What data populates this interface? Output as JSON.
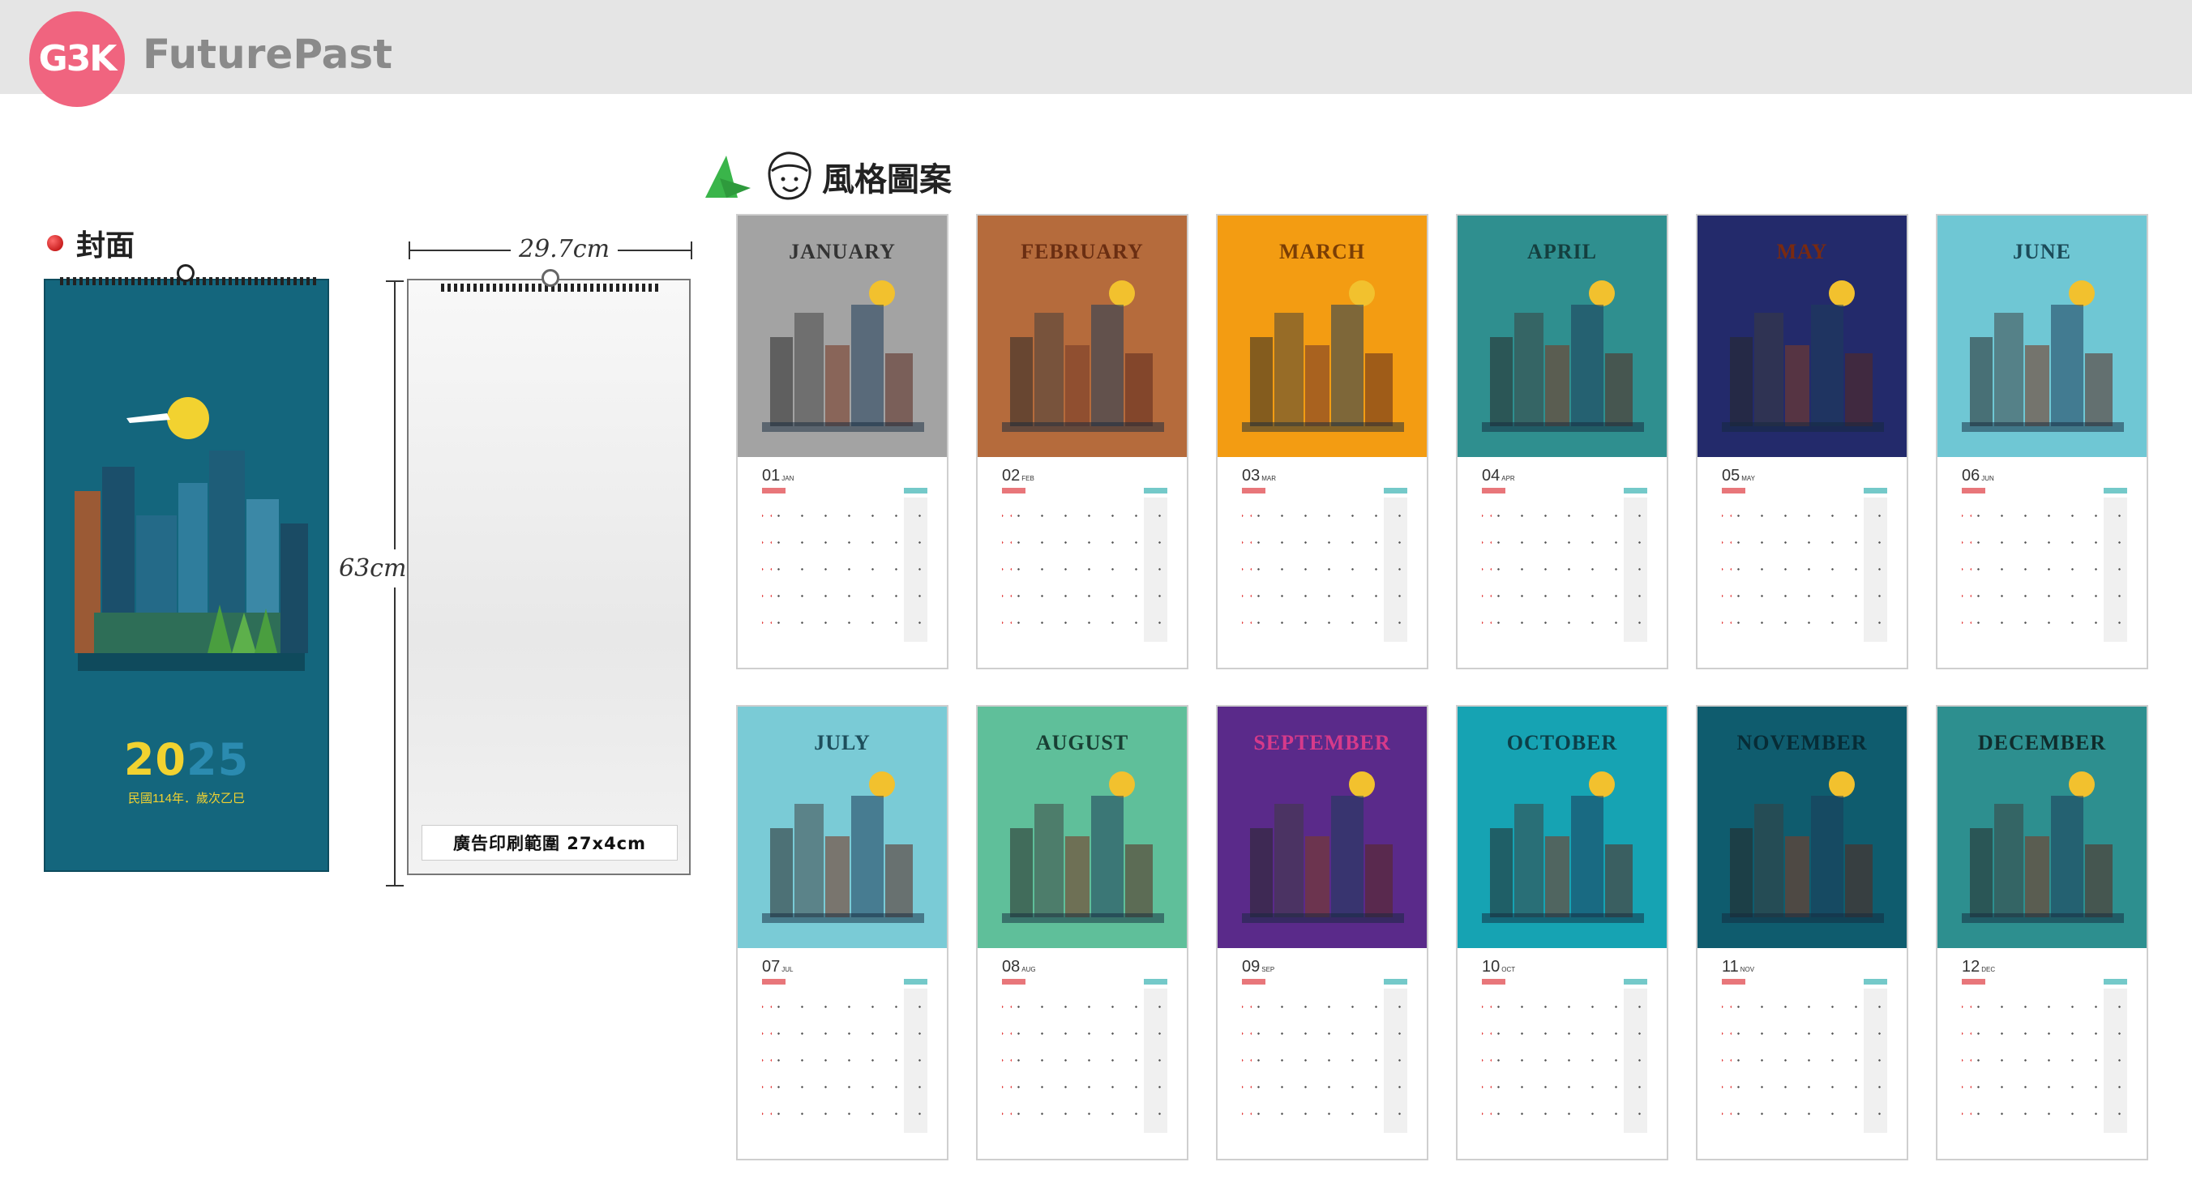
{
  "header": {
    "logo_text": "G3K",
    "brand": "FuturePast"
  },
  "cover_section": {
    "label": "封面",
    "year_part1": "20",
    "year_part2": "25",
    "subtitle": "民國114年．歲次乙巳"
  },
  "dimensions": {
    "width_label": "29.7cm",
    "height_label": "63cm",
    "ad_area_label": "廣告印刷範圍 27x4cm"
  },
  "style_section": {
    "title": "風格圖案"
  },
  "months": [
    {
      "name": "JANUARY",
      "num": "01",
      "abbr": "JAN",
      "bg": "#a3a3a3",
      "title_color": "#333333"
    },
    {
      "name": "FEBRUARY",
      "num": "02",
      "abbr": "FEB",
      "bg": "#b56b3c",
      "title_color": "#6a2e12"
    },
    {
      "name": "MARCH",
      "num": "03",
      "abbr": "MAR",
      "bg": "#f39c12",
      "title_color": "#7a3e05"
    },
    {
      "name": "APRIL",
      "num": "04",
      "abbr": "APR",
      "bg": "#2f8f8f",
      "title_color": "#143f3f"
    },
    {
      "name": "MAY",
      "num": "05",
      "abbr": "MAY",
      "bg": "#232a6b",
      "title_color": "#7a2a10"
    },
    {
      "name": "JUNE",
      "num": "06",
      "abbr": "JUN",
      "bg": "#6fc7d4",
      "title_color": "#1c4b59"
    },
    {
      "name": "JULY",
      "num": "07",
      "abbr": "JUL",
      "bg": "#7acbd6",
      "title_color": "#1d4e5c"
    },
    {
      "name": "AUGUST",
      "num": "08",
      "abbr": "AUG",
      "bg": "#5fbf9a",
      "title_color": "#183f33"
    },
    {
      "name": "SEPTEMBER",
      "num": "09",
      "abbr": "SEP",
      "bg": "#5a2a8a",
      "title_color": "#d63a8a"
    },
    {
      "name": "OCTOBER",
      "num": "10",
      "abbr": "OCT",
      "bg": "#16a3b3",
      "title_color": "#0c3f48"
    },
    {
      "name": "NOVEMBER",
      "num": "11",
      "abbr": "NOV",
      "bg": "#0f5c6e",
      "title_color": "#072c36"
    },
    {
      "name": "DECEMBER",
      "num": "12",
      "abbr": "DEC",
      "bg": "#2d8f8f",
      "title_color": "#102c2c"
    }
  ]
}
